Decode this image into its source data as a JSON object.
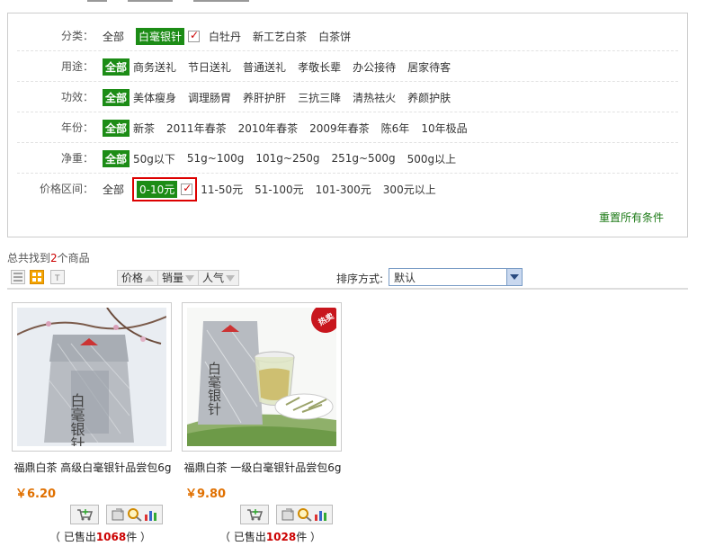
{
  "filters": [
    {
      "label": "分类：",
      "options": [
        {
          "text": "全部",
          "state": "normal"
        },
        {
          "text": "白毫银针",
          "state": "selected",
          "checked": true
        },
        {
          "text": "白牡丹",
          "state": "normal"
        },
        {
          "text": "新工艺白茶",
          "state": "normal"
        },
        {
          "text": "白茶饼",
          "state": "normal"
        }
      ]
    },
    {
      "label": "用途：",
      "options": [
        {
          "text": "全部",
          "state": "active"
        },
        {
          "text": "商务送礼",
          "state": "normal"
        },
        {
          "text": "节日送礼",
          "state": "normal"
        },
        {
          "text": "普通送礼",
          "state": "normal"
        },
        {
          "text": "孝敬长辈",
          "state": "normal"
        },
        {
          "text": "办公接待",
          "state": "normal"
        },
        {
          "text": "居家待客",
          "state": "normal"
        }
      ]
    },
    {
      "label": "功效：",
      "options": [
        {
          "text": "全部",
          "state": "active"
        },
        {
          "text": "美体瘦身",
          "state": "normal"
        },
        {
          "text": "调理肠胃",
          "state": "normal"
        },
        {
          "text": "养肝护肝",
          "state": "normal"
        },
        {
          "text": "三抗三降",
          "state": "normal"
        },
        {
          "text": "清热祛火",
          "state": "normal"
        },
        {
          "text": "养颜护肤",
          "state": "normal"
        }
      ]
    },
    {
      "label": "年份：",
      "options": [
        {
          "text": "全部",
          "state": "active"
        },
        {
          "text": "新茶",
          "state": "normal"
        },
        {
          "text": "2011年春茶",
          "state": "normal"
        },
        {
          "text": "2010年春茶",
          "state": "normal"
        },
        {
          "text": "2009年春茶",
          "state": "normal"
        },
        {
          "text": "陈6年",
          "state": "normal"
        },
        {
          "text": "10年极品",
          "state": "normal"
        }
      ]
    },
    {
      "label": "净重：",
      "options": [
        {
          "text": "全部",
          "state": "active"
        },
        {
          "text": "50g以下",
          "state": "normal"
        },
        {
          "text": "51g~100g",
          "state": "normal"
        },
        {
          "text": "101g~250g",
          "state": "normal"
        },
        {
          "text": "251g~500g",
          "state": "normal"
        },
        {
          "text": "500g以上",
          "state": "normal"
        }
      ]
    },
    {
      "label": "价格区间：",
      "options": [
        {
          "text": "全部",
          "state": "normal"
        },
        {
          "text": "0-10元",
          "state": "highlighted",
          "checked": true
        },
        {
          "text": "11-50元",
          "state": "normal"
        },
        {
          "text": "51-100元",
          "state": "normal"
        },
        {
          "text": "101-300元",
          "state": "normal"
        },
        {
          "text": "300元以上",
          "state": "normal"
        }
      ]
    }
  ],
  "reset_label": "重置所有条件",
  "result": {
    "prefix": "总共找到",
    "count": "2",
    "suffix": "个商品"
  },
  "toolbar": {
    "view_icons": [
      "list-view-icon",
      "grid-view-icon",
      "text-view-icon"
    ],
    "sort_buttons": [
      "价格",
      "销量",
      "人气"
    ],
    "sort_label": "排序方式:",
    "sort_value": "默认"
  },
  "products": [
    {
      "name": "福鼎白茶 高级白毫银针品尝包6g",
      "price": "￥6.20",
      "sold_prefix": "（ 已售出",
      "sold_count": "1068",
      "sold_suffix": "件 ）",
      "package_text": "白毫银针",
      "hot_badge": false
    },
    {
      "name": "福鼎白茶 一级白毫银针品尝包6g",
      "price": "￥9.80",
      "sold_prefix": "（ 已售出",
      "sold_count": "1028",
      "sold_suffix": "件 ）",
      "package_text": "白毫银针",
      "hot_badge": true,
      "badge_text": "热卖"
    }
  ],
  "colors": {
    "green": "#1c8c16",
    "red": "#cc0000",
    "price": "#e07000"
  }
}
